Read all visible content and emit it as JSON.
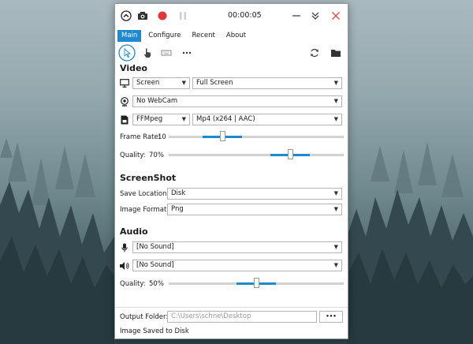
{
  "titlebar": {
    "timer": "00:00:05",
    "icons": [
      "expand-up-icon",
      "camera-icon",
      "record-icon",
      "pause-icon",
      "minimize-icon",
      "collapse-icon",
      "close-icon"
    ]
  },
  "menu": {
    "items": [
      "Main",
      "Configure",
      "Recent",
      "About"
    ],
    "active": "Main"
  },
  "toolbar": {
    "icons": [
      "cursor-icon",
      "click-icon",
      "keyboard-icon",
      "more-icon",
      "refresh-icon",
      "folder-icon"
    ]
  },
  "video": {
    "heading": "Video",
    "source": "Screen",
    "region": "Full Screen",
    "webcam": "No WebCam",
    "writer": "FFMpeg",
    "codec": "Mp4 (x264 | AAC)",
    "frame_rate_label": "Frame Rate:",
    "frame_rate": "10",
    "frame_rate_level": 0.3,
    "quality_label": "Quality:",
    "quality": "70%",
    "quality_level": 0.7
  },
  "screenshot": {
    "heading": "ScreenShot",
    "save_location_label": "Save Location:",
    "save_location": "Disk",
    "image_format_label": "Image Format:",
    "image_format": "Png"
  },
  "audio": {
    "heading": "Audio",
    "microphone": "[No Sound]",
    "speaker": "[No Sound]",
    "quality_label": "Quality:",
    "quality": "50%",
    "quality_level": 0.5
  },
  "footer": {
    "output_folder_label": "Output Folder:",
    "output_folder": "C:\\Users\\schne\\Desktop",
    "browse_label": "•••",
    "status": "Image Saved to Disk"
  },
  "colors": {
    "accent": "#1e88d0",
    "record": "#e0383a",
    "close": "#e84a4a"
  }
}
